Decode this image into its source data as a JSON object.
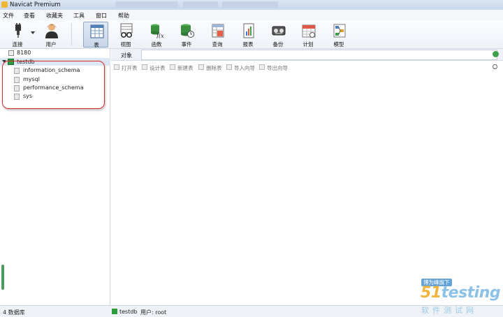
{
  "window": {
    "title": "Navicat Premium"
  },
  "menu": [
    "文件",
    "查看",
    "收藏夹",
    "工具",
    "窗口",
    "帮助"
  ],
  "toolbar": [
    {
      "id": "connect",
      "label": "连接",
      "icon": "plug-icon"
    },
    {
      "id": "user",
      "label": "用户",
      "icon": "user-icon"
    },
    {
      "id": "table",
      "label": "表",
      "icon": "table-icon",
      "active": true
    },
    {
      "id": "view",
      "label": "视图",
      "icon": "view-icon"
    },
    {
      "id": "function",
      "label": "函数",
      "icon": "function-icon"
    },
    {
      "id": "event",
      "label": "事件",
      "icon": "event-icon"
    },
    {
      "id": "query",
      "label": "查询",
      "icon": "query-icon"
    },
    {
      "id": "report",
      "label": "报表",
      "icon": "report-icon"
    },
    {
      "id": "backup",
      "label": "备份",
      "icon": "backup-icon"
    },
    {
      "id": "schedule",
      "label": "计划",
      "icon": "calendar-icon"
    },
    {
      "id": "model",
      "label": "模型",
      "icon": "model-icon"
    }
  ],
  "sidebar": {
    "connection": "8180",
    "database": "testdb",
    "schemas": [
      "information_schema",
      "mysql",
      "performance_schema",
      "sys"
    ]
  },
  "objects": {
    "label": "对象",
    "actions": [
      "打开表",
      "设计表",
      "新建表",
      "删除表",
      "导入向导",
      "导出向导"
    ]
  },
  "status": {
    "left": "4 数据库",
    "db": "testdb",
    "user": "用户: root"
  },
  "watermark": {
    "tag": "博为峰旗下",
    "brand_num": "51",
    "brand_word": "testing",
    "cn": "软件测试网"
  },
  "colors": {
    "highlight": "#d62b2b",
    "db_icon": "#2e9a3e",
    "selection": "#dde7f4"
  }
}
